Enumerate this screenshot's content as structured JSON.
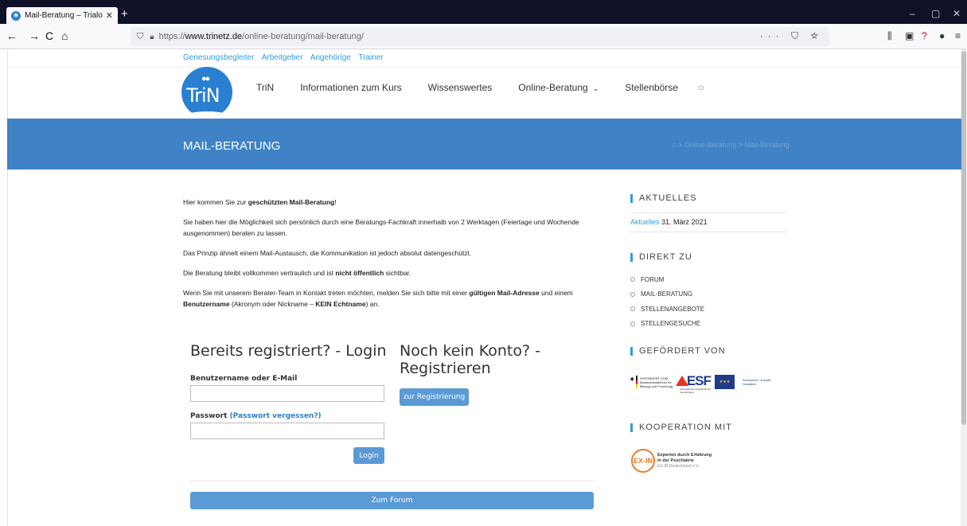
{
  "browser": {
    "tab_title": "Mail-Beratung – Trialog im Net",
    "tab_close": "✕",
    "new_tab": "+",
    "url_protocol": "https://",
    "url_domain": "www.trinetz.de",
    "url_path": "/online-beratung/mail-beratung/",
    "url_actions": "··· ⛉ ☆",
    "nav_back": "←",
    "nav_forward": "→",
    "nav_reload": "C",
    "nav_home": "⌂",
    "win_min": "–",
    "win_max": "▢",
    "win_close": "✕",
    "tool_library": "⫼",
    "tool_sidebar": "▣",
    "tool_help": "?",
    "tool_account": "●",
    "tool_menu": "≡"
  },
  "site": {
    "toplinks": [
      "Genesungsbegleiter",
      "Arbeitgeber",
      "Angehörige",
      "Trainer"
    ],
    "logo_text": "TriN",
    "logo_dots": "●●",
    "nav": {
      "trin": "TriN",
      "kurs": "Informationen zum Kurs",
      "wissen": "Wissenswertes",
      "online": "Online-Beratung",
      "stellen": "Stellenbörse",
      "chevron": "⌄",
      "search": "○"
    },
    "banner_title": "MAIL-BERATUNG",
    "breadcrumb": {
      "home": "⌂",
      "sep": ">",
      "item1": "Online-Beratung",
      "item2": "Mail-Beratung"
    }
  },
  "content": {
    "p1_a": "Hier kommen Sie zur ",
    "p1_b": "geschützten Mail-Beratung",
    "p1_c": "!",
    "p2": "Sie haben hier die Möglichkeit sich persönlich durch eine Beratungs-Fachkraft innerhalb von 2 Werktagen (Feiertage und Wochende ausgenommen) beraten zu lassen.",
    "p3": "Das Prinzip ähnelt einem Mail-Austausch, die Kommunikation ist jedoch absolut datengeschützt.",
    "p4_a": "Die Beratung bleibt vollkommen vertraulich und ist ",
    "p4_b": "nicht öffentlich",
    "p4_c": " sichtbar.",
    "p5_a": "Wenn Sie mit unserem Berater-Team in Kontakt treten möchten, melden Sie sich bitte mit einer ",
    "p5_b": "gültigen Mail-Adresse",
    "p5_c": " und einem ",
    "p5_d": "Benutzername",
    "p5_e": " (Akronym oder Nickname – ",
    "p5_f": "KEIN Echtname",
    "p5_g": ") an."
  },
  "login": {
    "title": "Bereits registriert? - Login",
    "user_label": "Benutzername oder E-Mail",
    "user_value": "",
    "pass_label": "Passwort",
    "forgot_label": "(Passwort vergessen?)",
    "pass_value": "",
    "login_button": "Login",
    "forum_button": "Zum Forum"
  },
  "register": {
    "title": "Noch kein Konto? - Registrieren",
    "button": "zur Registrierung"
  },
  "sidebar": {
    "aktuelles_title": "AKTUELLES",
    "aktuelles_link": "Aktuelles",
    "aktuelles_date": "31. März 2021",
    "direkt_title": "DIREKT ZU",
    "direkt_items": [
      "FORUM",
      "MAIL-BERATUNG",
      "STELLENANGEBOTE",
      "STELLENGESUCHE"
    ],
    "gefoerdert_title": "GEFÖRDERT VON",
    "kooperation_title": "KOOPERATION MIT",
    "sponsor_bmbf": "Bundesministerium für Bildung und Forschung",
    "sponsor_bmbf_top": "GEFÖRDERT VOM",
    "sponsor_esf": "ESF",
    "sponsor_esf_sub": "Europäischer Sozialfonds für Deutschland",
    "sponsor_eu": "Europäische Union",
    "sponsor_zukunft": "Zusammen. Zukunft. Gestalten.",
    "exin_mark": "EX-IN",
    "exin_line1": "Experten durch Erfahrung",
    "exin_line2": "in der Psychiatrie",
    "exin_line3": "EX-IN Deutschland e.V."
  },
  "colors": {
    "brand_blue": "#3f83c6",
    "link_blue": "#2b9fe0",
    "button_blue": "#5b9bd5"
  }
}
